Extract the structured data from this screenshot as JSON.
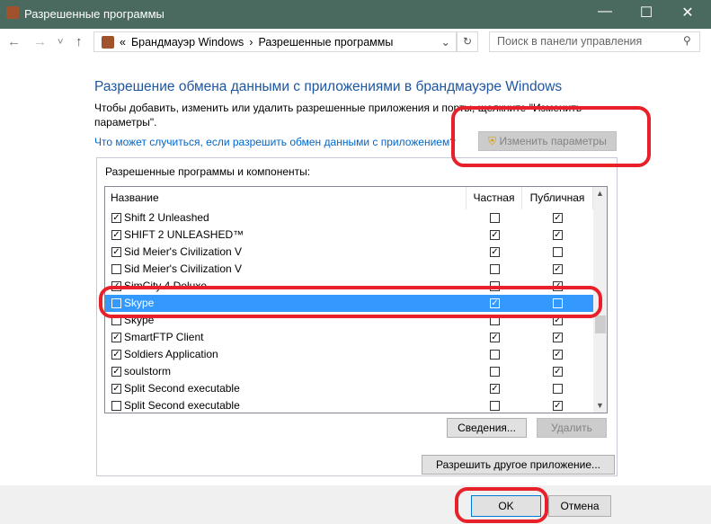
{
  "window": {
    "title": "Разрешенные программы",
    "minimize": "—",
    "maximize": "☐",
    "close": "✕"
  },
  "nav": {
    "back": "←",
    "forward": "→",
    "recent": "˅",
    "up": "↑",
    "breadcrumb_prefix": "«",
    "breadcrumb": [
      "Брандмауэр Windows",
      "Разрешенные программы"
    ],
    "separator": "›",
    "refresh": "↻",
    "search_placeholder": "Поиск в панели управления"
  },
  "main": {
    "heading": "Разрешение обмена данными с приложениями в брандмауэре Windows",
    "description": "Чтобы добавить, изменить или удалить разрешенные приложения и порты, щелкните \"Изменить параметры\".",
    "risk_link": "Что может случиться, если разрешить обмен данными с приложением?",
    "change_settings": "Изменить параметры",
    "group_label": "Разрешенные программы и компоненты:",
    "columns": [
      "Название",
      "Частная",
      "Публичная"
    ],
    "rows": [
      {
        "name": "Shift 2 Unleashed",
        "enabled": true,
        "private": false,
        "public": true
      },
      {
        "name": "SHIFT 2 UNLEASHED™",
        "enabled": true,
        "private": true,
        "public": true
      },
      {
        "name": "Sid Meier's Civilization V",
        "enabled": true,
        "private": true,
        "public": false
      },
      {
        "name": "Sid Meier's Civilization V",
        "enabled": false,
        "private": false,
        "public": true
      },
      {
        "name": "SimCity 4 Deluxe",
        "enabled": true,
        "private": false,
        "public": true
      },
      {
        "name": "Skype",
        "enabled": false,
        "private": true,
        "public": false,
        "selected": true
      },
      {
        "name": "Skype",
        "enabled": false,
        "private": false,
        "public": true
      },
      {
        "name": "SmartFTP Client",
        "enabled": true,
        "private": true,
        "public": true
      },
      {
        "name": "Soldiers Application",
        "enabled": true,
        "private": false,
        "public": true
      },
      {
        "name": "soulstorm",
        "enabled": true,
        "private": false,
        "public": true
      },
      {
        "name": "Split Second executable",
        "enabled": true,
        "private": true,
        "public": false
      },
      {
        "name": "Split Second executable",
        "enabled": false,
        "private": false,
        "public": true
      }
    ],
    "details": "Сведения...",
    "remove": "Удалить",
    "allow_other": "Разрешить другое приложение..."
  },
  "footer": {
    "ok": "OK",
    "cancel": "Отмена"
  },
  "colors": {
    "titlebar": "#4b6a5f",
    "selection": "#3399ff",
    "annotation": "#e8202a",
    "heading": "#1e56a0"
  }
}
